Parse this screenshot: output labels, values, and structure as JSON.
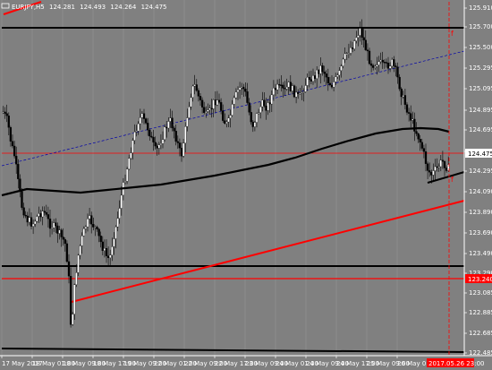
{
  "header": {
    "symbol": "EURJPY,H5",
    "bid": "124.281",
    "high": "124.493",
    "low": "124.264",
    "close": "124.475"
  },
  "colors": {
    "background": "#808080",
    "grid": "#999999",
    "bull_candle": "#ffffff",
    "bear_candle": "#000000",
    "wick": "#000000",
    "moving_average": "#000000",
    "support_line": "#000000",
    "trend_line": "#ff0000",
    "price_line": "#ff0000",
    "upper_channel": "#0000aa",
    "current_price_box": "#ffffff",
    "marked_price_box": "#ff0000",
    "time_box": "#ff0000"
  },
  "price_axis": {
    "labels": [
      "125.910",
      "125.700",
      "125.500",
      "125.295",
      "125.095",
      "124.895",
      "124.695",
      "124.490",
      "124.295",
      "124.090",
      "123.890",
      "123.690",
      "123.490",
      "123.290",
      "123.085",
      "122.885",
      "122.685",
      "122.485"
    ],
    "current_price": "124.475",
    "marked_price": "123.240"
  },
  "time_axis": {
    "labels": [
      "17 May 2017",
      "18 May 01:00",
      "18 May 09:00",
      "18 May 17:00",
      "19 May 09:00",
      "22 May 01:00",
      "22 May 09:00",
      "22 May 17:00",
      "23 May 09:00",
      "24 May 01:00",
      "24 May 09:00",
      "24 May 17:00",
      "25 May 09:00",
      "26 May 01:00"
    ],
    "current_time": "2017.05.26 23:00"
  },
  "icons": {
    "chart_icon": "chart-window-icon"
  }
}
